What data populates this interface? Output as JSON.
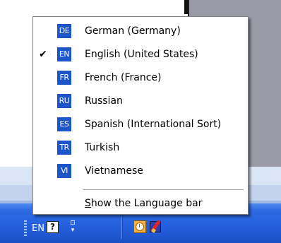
{
  "menu": {
    "items": [
      {
        "code": "DE",
        "label": "German (Germany)",
        "checked": false
      },
      {
        "code": "EN",
        "label": "English (United States)",
        "checked": true
      },
      {
        "code": "FR",
        "label": "French (France)",
        "checked": false
      },
      {
        "code": "RU",
        "label": "Russian",
        "checked": false
      },
      {
        "code": "ES",
        "label": "Spanish (International Sort)",
        "checked": false
      },
      {
        "code": "TR",
        "label": "Turkish",
        "checked": false
      },
      {
        "code": "VI",
        "label": "Vietnamese",
        "checked": false
      }
    ],
    "checkmark": "✔",
    "show_bar": {
      "mnemonic": "S",
      "rest": "how the Language bar"
    }
  },
  "taskbar": {
    "language": "EN",
    "help_glyph": "?",
    "options_glyph_top": "⊡",
    "options_glyph_bottom": "▾",
    "icons": [
      "help-icon",
      "options-menu-icon",
      "clock-icon",
      "pen-app-icon"
    ]
  },
  "colors": {
    "badge": "#1c55c9",
    "taskbar": "#235fdc"
  }
}
